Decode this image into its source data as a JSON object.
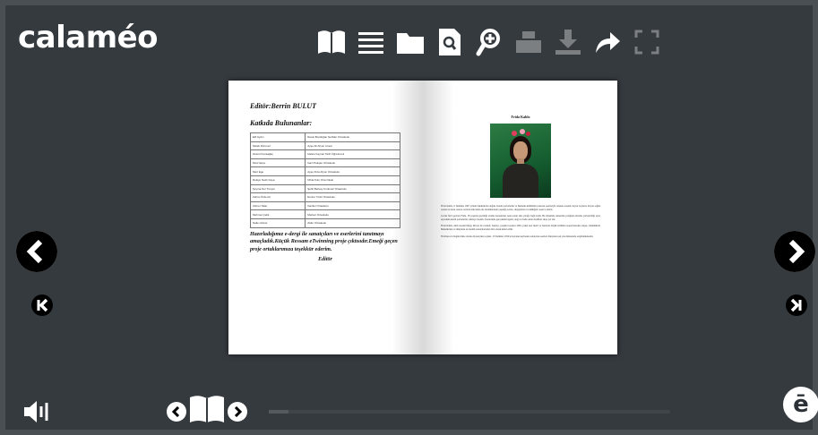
{
  "app": {
    "logo_text": "calaméo"
  },
  "toolbar": [
    {
      "name": "open-book-icon",
      "enabled": true
    },
    {
      "name": "list-icon",
      "enabled": true
    },
    {
      "name": "folder-icon",
      "enabled": true
    },
    {
      "name": "search-document-icon",
      "enabled": true
    },
    {
      "name": "zoom-in-icon",
      "enabled": true
    },
    {
      "name": "print-icon",
      "enabled": false
    },
    {
      "name": "download-icon",
      "enabled": false
    },
    {
      "name": "share-icon",
      "enabled": true
    },
    {
      "name": "fullscreen-icon",
      "enabled": false
    }
  ],
  "left_page": {
    "heading": "Editör:Berrin BULUT",
    "subheading": "Katkıda Bulunanlar:",
    "table_rows": [
      [
        "Elif Aydın",
        "Recai Bozdoğan Şehitler Ortaokulu"
      ],
      [
        "Melek Dönmez",
        "Ayşe Ali Afyon Lisesi"
      ],
      [
        "Hüsnü Kocaağaç",
        "Hatice Kaynar Tarih Öğretmeni"
      ],
      [
        "Mısır Epçe",
        "Gazi Pekşen Ortaokulu"
      ],
      [
        "Mert Ege",
        "Ayşe Rıza Afyon Ortaokulu"
      ],
      [
        "Rukiye Nazlı Kaya",
        "Nihat Kılıç Orta Okulu"
      ],
      [
        "Şeyma Nur Tunçer",
        "Şehit Berkay Korkmaz Ortaokulu"
      ],
      [
        "Zehra Özdemir",
        "Emine Yıldız Ortaokulu"
      ],
      [
        "Ahmet Tatar",
        "Gaziler Ortaokulu"
      ],
      [
        "Mehmet Çelik",
        "Merkez Ortaokulu"
      ],
      [
        "Naile Hüsnü",
        "Zafer Ortaokulu"
      ]
    ],
    "paragraph": "Hazırladığımız e-dergi ile sanatçıları ve eserlerini tanıtmayı amaçladık.Küçük Ressam eTwinning proje çıktısıdır.Emeği geçen proje ortaklarımıza teşekkür ederim.",
    "signature": "Editör"
  },
  "right_page": {
    "title": "Frida Kahlo",
    "paragraphs": [
      "Frida Kahlo, 6 Temmuz 1907 yılında Meksika'da doğdu. Kendi portrelerini ve Meksika kültürünü yansıtan eserleriyle tanınan ressam, hayatı boyunca birçok sağlık sorunu ve kaza sonrası acılarla mücadele etti. Resimlerinde yaşadığı acıları, duygularını ve kimliğini cesurca anlattı.",
      "Çocuk felci geçiren Frida, 18 yaşında geçirdiği otobüs kazasından sonra uzun süre yatağa bağlı kaldı. Bu dönemde annesinin yatağının üzerine yerleştirdiği ayna sayesinde kendi portrelerini çizmeye başladı. Eserlerinde gerçeküstü ögeler, doğa ve halk sanatı motifleri sıkça yer alır.",
      "Frida Kahlo, ünlü ressam Diego Rivera ile evlendi. Sanatçı, yaşamı boyunca 200'e yakın eser üretti ve bunların büyük bölümü otoportrelerden oluşur. Günümüzde Meksika'nın ve dünyanın en önemli sanatçılarından biri olarak kabul edilir.",
      "Frida'nın evi bugün müze olarak ziyaretçilere açıktır. 13 Temmuz 1954'te hayatını kaybeden sanatçının eserleri dünyanın pek çok müzesinde sergilenmektedir."
    ]
  },
  "navigation": {
    "prev_label": "Önceki sayfa",
    "next_label": "Sonraki sayfa"
  },
  "progress": {
    "fraction": 0.05
  },
  "badge": {
    "letter": "ē"
  }
}
